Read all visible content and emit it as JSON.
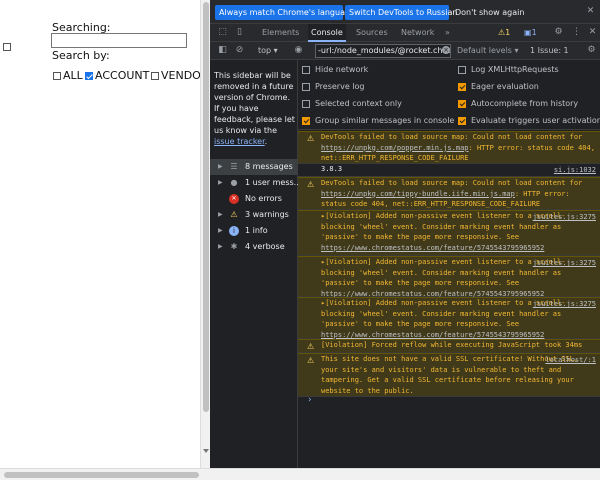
{
  "page": {
    "search_label": "Searching:",
    "search_value": "",
    "search_by_label": "Search by:",
    "filters": [
      {
        "label": "ALL",
        "checked": false
      },
      {
        "label": "ACCOUNT",
        "checked": true
      },
      {
        "label": "VENDO",
        "checked": false
      }
    ]
  },
  "devtools": {
    "infobar": {
      "match_language": "Always match Chrome's language",
      "switch_russian": "Switch DevTools to Russian",
      "dont_show": "Don't show again"
    },
    "tabs": {
      "elements": "Elements",
      "console": "Console",
      "sources": "Sources",
      "network": "Network",
      "more": "»"
    },
    "badges": {
      "warnings": "1",
      "issues": "1"
    },
    "toolbar": {
      "context": "top ▾",
      "filter_value": "-url:/node_modules/@rocket.chat/",
      "levels": "Default levels ▾",
      "issues_count": "1 Issue: 1"
    },
    "settings": {
      "hide_network": "Hide network",
      "preserve_log": "Preserve log",
      "selected_context": "Selected context only",
      "group_similar": "Group similar messages in console",
      "log_xhr": "Log XMLHttpRequests",
      "eager_eval": "Eager evaluation",
      "autocomplete": "Autocomplete from history",
      "eval_triggers": "Evaluate triggers user activation"
    },
    "sidebar": {
      "note": "This sidebar will be removed in a future version of Chrome. If you have feedback, please let us know via the",
      "note_link": "issue tracker",
      "note_end": ".",
      "items": [
        {
          "label": "8 messages",
          "icon": "list-icon",
          "glyph": "☰"
        },
        {
          "label": "1 user mess...",
          "icon": "user-icon",
          "glyph": "●"
        },
        {
          "label": "No errors",
          "icon": "error-icon",
          "glyph": "✕"
        },
        {
          "label": "3 warnings",
          "icon": "warning-icon",
          "glyph": "⚠"
        },
        {
          "label": "1 info",
          "icon": "info-icon",
          "glyph": "i"
        },
        {
          "label": "4 verbose",
          "icon": "verbose-icon",
          "glyph": "✱"
        }
      ]
    },
    "messages": [
      {
        "type": "warn",
        "text": "DevTools failed to load source map: Could not load content for",
        "link": "https://unpkg.com/popper.min.js.map",
        "rest": ": HTTP error: status code 404, net::ERR_HTTP_RESPONSE_CODE_FAILURE",
        "src": ""
      },
      {
        "type": "plain",
        "text": "3.8.3",
        "src": "si.js:1032"
      },
      {
        "type": "warn",
        "text": "DevTools failed to load source map: Could not load content for",
        "link": "https://unpkg.com/tippy-bundle.iife.min.js.map",
        "rest": ": HTTP error: status code 404, net::ERR_HTTP_RESPONSE_CODE_FAILURE",
        "src": ""
      },
      {
        "type": "warn",
        "text": "▸[Violation] Added non-passive event listener to a scroll-blocking 'wheel' event. Consider marking event handler as 'passive' to make the page more responsive. See",
        "link": "https://www.chromestatus.com/feature/5745543795965952",
        "rest": "",
        "src": "jsuites.js:3275"
      },
      {
        "type": "warn",
        "text": "▸[Violation] Added non-passive event listener to a scroll-blocking 'wheel' event. Consider marking event handler as 'passive' to make the page more responsive. See",
        "link": "https://www.chromestatus.com/feature/5745543795965952",
        "rest": "",
        "src": "jsuites.js:3275"
      },
      {
        "type": "warn",
        "text": "▸[Violation] Added non-passive event listener to a scroll-blocking 'wheel' event. Consider marking event handler as 'passive' to make the page more responsive. See",
        "link": "https://www.chromestatus.com/feature/5745543795965952",
        "rest": "",
        "src": "jsuites.js:3275"
      },
      {
        "type": "warn",
        "text": "[Violation] Forced reflow while executing JavaScript took 34ms",
        "link": "",
        "rest": "",
        "src": ""
      },
      {
        "type": "warn",
        "text": "This site does not have a valid SSL certificate! Without SSL, your site's and visitors' data is vulnerable to theft and tampering. Get a valid SSL certificate before releasing your website to the public.",
        "link": "",
        "rest": "",
        "src": "localhost/:1"
      }
    ],
    "prompt": "›"
  }
}
